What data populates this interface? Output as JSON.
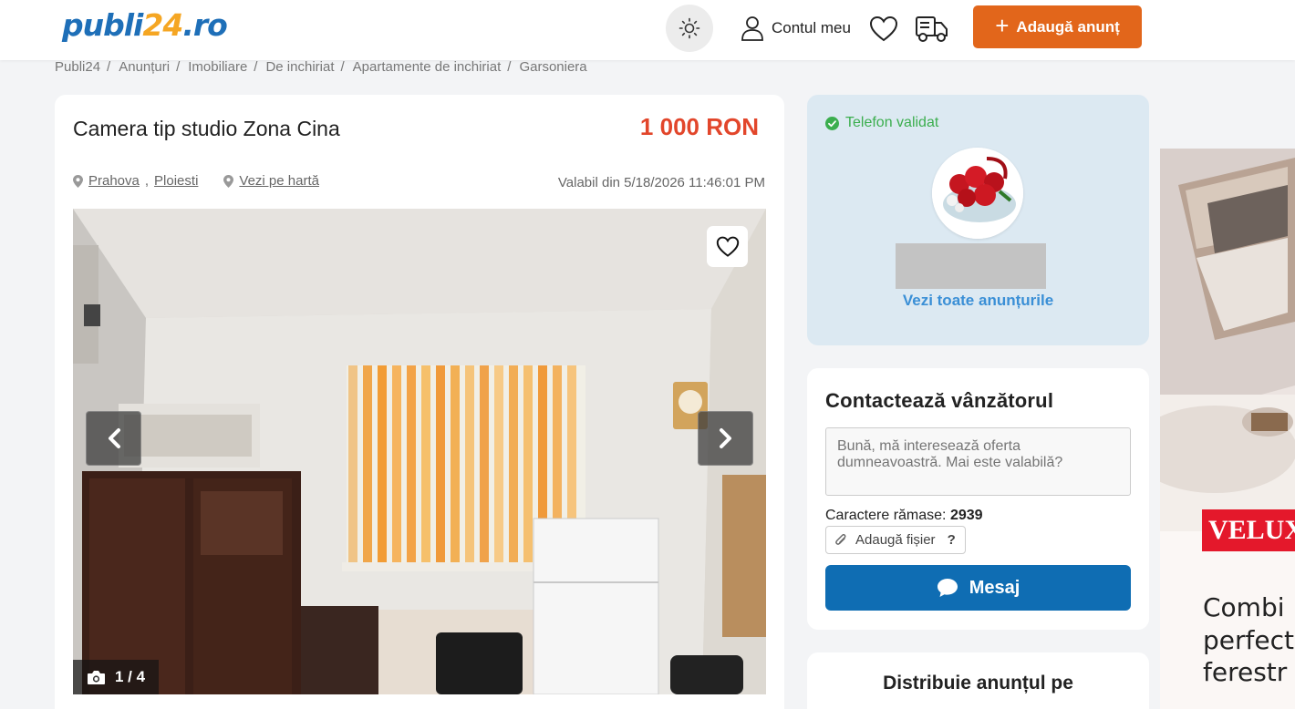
{
  "header": {
    "logo_main": "publi",
    "logo_num": "24",
    "logo_tld": ".ro",
    "account_label": "Contul meu",
    "add_button_label": "Adaugă anunț"
  },
  "breadcrumb": [
    "Publi24",
    "Anunțuri",
    "Imobiliare",
    "De inchiriat",
    "Apartamente de inchiriat",
    "Garsoniera"
  ],
  "listing": {
    "title": "Camera tip studio Zona Cina",
    "price": "1 000 RON",
    "county": "Prahova",
    "city": "Ploiesti",
    "map_link": "Vezi pe hartă",
    "valid_since": "Valabil din 5/18/2026 11:46:01 PM",
    "photo_counter": "1 / 4"
  },
  "seller": {
    "verified_label": "Telefon validat",
    "all_ads_link": "Vezi toate anunțurile"
  },
  "contact": {
    "title": "Contactează vânzătorul",
    "message_placeholder": "Bună, mă interesează oferta dumneavoastră. Mai este valabilă?",
    "chars_label": "Caractere rămase:",
    "chars_count": "2939",
    "attach_label": "Adaugă fișier",
    "attach_help": "?",
    "send_label": "Mesaj"
  },
  "share": {
    "title": "Distribuie anunțul pe"
  },
  "ad": {
    "brand": "VELUX",
    "lines": [
      "Combi",
      "perfect",
      "ferestr"
    ]
  },
  "colors": {
    "brand_blue": "#1e6fb8",
    "brand_orange": "#e2661b",
    "price_red": "#e2462b",
    "verified_green": "#3bae4e",
    "send_blue": "#0f6db3"
  }
}
